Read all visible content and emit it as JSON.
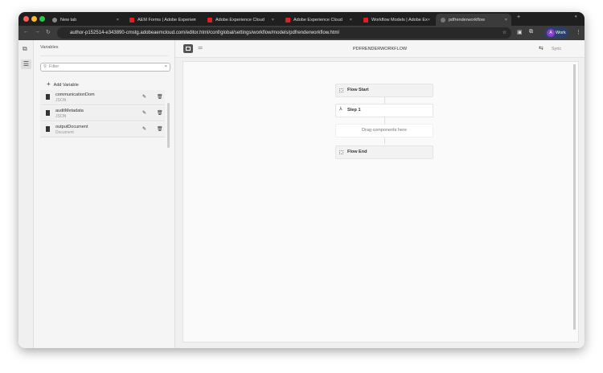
{
  "browser": {
    "tabs": [
      {
        "label": "New tab"
      },
      {
        "label": "AEM Forms | Adobe Experien"
      },
      {
        "label": "Adobe Experience Cloud"
      },
      {
        "label": "Adobe Experience Cloud"
      },
      {
        "label": "Workflow Models | Adobe Ex"
      },
      {
        "label": "pdfrenderworkflow"
      }
    ],
    "url": "author-p152514-e343890-cmstg.adobeaemcloud.com/editor.html/conf/global/settings/workflow/models/pdfrenderworkflow.html",
    "profile": "Work"
  },
  "sidebar": {
    "title": "Variables",
    "filter_placeholder": "Filter",
    "add_label": "Add Variable",
    "variables": [
      {
        "name": "communicationDom",
        "type": "JSON"
      },
      {
        "name": "auditMetadata",
        "type": "JSON"
      },
      {
        "name": "outputDocument",
        "type": "Document"
      }
    ]
  },
  "editor": {
    "title": "PDFRENDERWORKFLOW",
    "sync_label": "Sync",
    "nodes": {
      "start": "Flow Start",
      "step": "Step 1",
      "drop": "Drag components here",
      "end": "Flow End"
    }
  }
}
